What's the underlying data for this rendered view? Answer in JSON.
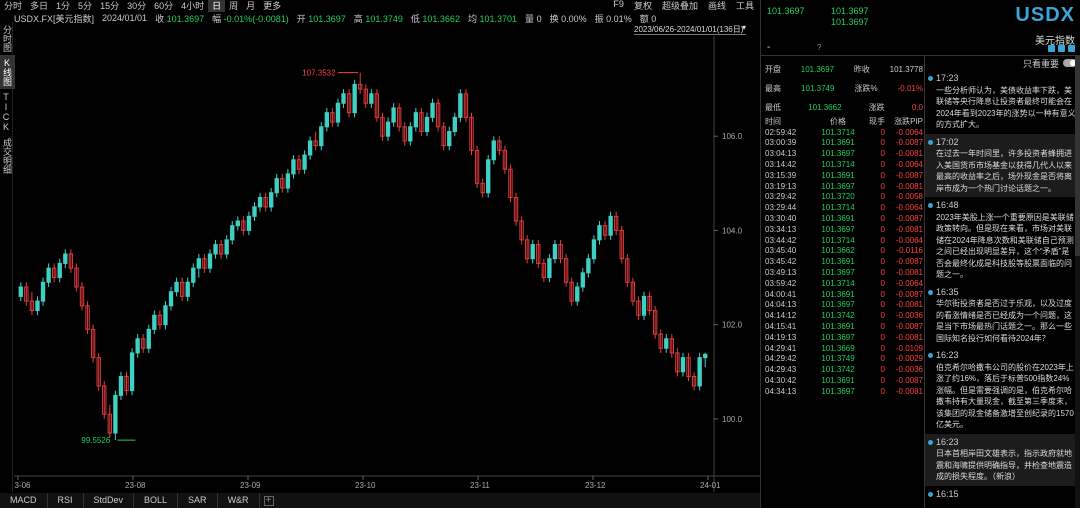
{
  "toolbar": {
    "periods": [
      "分时",
      "多日",
      "1分",
      "5分",
      "15分",
      "30分",
      "60分",
      "4小时",
      "日",
      "周",
      "月",
      "更多"
    ],
    "active_period": "日",
    "right_items": [
      "F9",
      "复权",
      "超级叠加",
      "画线",
      "工具"
    ]
  },
  "infobar": {
    "symbol": "USDX.FX[美元指数]",
    "date": "2024/01/01",
    "close_label": "收",
    "close": "101.3697",
    "change_label": "幅",
    "change": "-0.01%(-0.0081)",
    "open_label": "开",
    "open": "101.3697",
    "high_label": "高",
    "high": "101.3749",
    "low_label": "低",
    "low": "101.3662",
    "avg_label": "均",
    "avg": "101.3701",
    "vol_label": "量",
    "vol": "0",
    "turnover_label": "换",
    "turnover": "0.00%",
    "amp_label": "振",
    "amp": "0.01%",
    "amount_label": "额",
    "amount": "0"
  },
  "left_tabs": [
    "分时图",
    "K线图",
    "TICK",
    "成交明细"
  ],
  "range": "2023/06/26-2024/01/01(136日)",
  "bottom_indicators": [
    "MACD",
    "RSI",
    "StdDev",
    "BOLL",
    "SAR",
    "W&R"
  ],
  "chart_data": {
    "type": "candlestick",
    "ylim": [
      99.0,
      108.0
    ],
    "y_ticks": [
      100.0,
      102.0,
      104.0,
      106.0
    ],
    "y_tick_labels": [
      "100.0",
      "102.0",
      "104.0",
      "106.0"
    ],
    "x_tick_labels": [
      "23-06",
      "23-08",
      "23-09",
      "23-10",
      "23-11",
      "23-12",
      "24-01"
    ],
    "high_marker": "107.3532",
    "low_marker": "99.5526",
    "up_color": "#3fd0c4",
    "down_color": "#e23b3b",
    "candles": [
      [
        102.6,
        102.9,
        102.5,
        102.8
      ],
      [
        102.8,
        102.9,
        102.4,
        102.5
      ],
      [
        102.5,
        102.7,
        102.2,
        102.3
      ],
      [
        102.3,
        102.6,
        102.2,
        102.5
      ],
      [
        102.5,
        103.0,
        102.4,
        102.9
      ],
      [
        102.9,
        103.3,
        102.8,
        103.2
      ],
      [
        103.2,
        103.3,
        102.9,
        103.0
      ],
      [
        103.0,
        103.4,
        102.9,
        103.3
      ],
      [
        103.3,
        103.6,
        103.2,
        103.5
      ],
      [
        103.5,
        103.6,
        103.1,
        103.2
      ],
      [
        103.2,
        103.3,
        102.7,
        102.8
      ],
      [
        102.8,
        102.9,
        102.3,
        102.4
      ],
      [
        102.4,
        102.5,
        101.8,
        101.9
      ],
      [
        101.9,
        102.0,
        101.2,
        101.3
      ],
      [
        101.3,
        101.4,
        100.6,
        100.7
      ],
      [
        100.7,
        100.8,
        100.0,
        100.1
      ],
      [
        100.1,
        100.3,
        99.6,
        99.7
      ],
      [
        99.7,
        100.6,
        99.55,
        100.5
      ],
      [
        100.5,
        101.0,
        100.4,
        100.9
      ],
      [
        100.9,
        101.0,
        100.5,
        100.6
      ],
      [
        100.6,
        101.5,
        100.5,
        101.4
      ],
      [
        101.4,
        101.8,
        101.3,
        101.7
      ],
      [
        101.7,
        101.8,
        101.4,
        101.5
      ],
      [
        101.5,
        102.0,
        101.4,
        101.9
      ],
      [
        101.9,
        102.3,
        101.8,
        102.2
      ],
      [
        102.2,
        102.3,
        101.9,
        102.0
      ],
      [
        102.0,
        102.5,
        101.9,
        102.4
      ],
      [
        102.4,
        102.8,
        102.3,
        102.7
      ],
      [
        102.7,
        103.0,
        102.6,
        102.9
      ],
      [
        102.9,
        103.0,
        102.5,
        102.6
      ],
      [
        102.6,
        103.0,
        102.5,
        102.9
      ],
      [
        102.9,
        103.3,
        102.8,
        103.2
      ],
      [
        103.2,
        103.5,
        103.0,
        103.4
      ],
      [
        103.4,
        103.5,
        103.1,
        103.2
      ],
      [
        103.2,
        103.6,
        103.1,
        103.5
      ],
      [
        103.5,
        103.8,
        103.4,
        103.7
      ],
      [
        103.7,
        103.8,
        103.4,
        103.5
      ],
      [
        103.5,
        103.9,
        103.4,
        103.8
      ],
      [
        103.8,
        104.2,
        103.7,
        104.1
      ],
      [
        104.1,
        104.3,
        104.0,
        104.2
      ],
      [
        104.2,
        104.3,
        103.9,
        104.0
      ],
      [
        104.0,
        104.4,
        103.9,
        104.3
      ],
      [
        104.3,
        104.6,
        104.2,
        104.5
      ],
      [
        104.5,
        104.8,
        104.4,
        104.7
      ],
      [
        104.7,
        104.8,
        104.4,
        104.5
      ],
      [
        104.5,
        104.9,
        104.4,
        104.8
      ],
      [
        104.8,
        105.2,
        104.7,
        105.1
      ],
      [
        105.1,
        105.2,
        104.8,
        104.9
      ],
      [
        104.9,
        105.3,
        104.8,
        105.2
      ],
      [
        105.2,
        105.6,
        105.1,
        105.5
      ],
      [
        105.5,
        105.6,
        105.2,
        105.3
      ],
      [
        105.3,
        105.7,
        105.2,
        105.6
      ],
      [
        105.6,
        106.0,
        105.5,
        105.9
      ],
      [
        105.9,
        106.1,
        105.7,
        105.8
      ],
      [
        105.8,
        106.3,
        105.7,
        106.2
      ],
      [
        106.2,
        106.6,
        106.1,
        106.5
      ],
      [
        106.5,
        106.6,
        106.2,
        106.3
      ],
      [
        106.3,
        106.8,
        106.2,
        106.7
      ],
      [
        106.7,
        107.0,
        106.6,
        106.9
      ],
      [
        106.9,
        107.0,
        106.4,
        106.5
      ],
      [
        106.5,
        107.2,
        106.4,
        107.1
      ],
      [
        107.1,
        107.35,
        106.9,
        107.0
      ],
      [
        107.0,
        107.1,
        106.6,
        106.7
      ],
      [
        106.7,
        107.0,
        106.6,
        106.9
      ],
      [
        106.9,
        107.0,
        106.3,
        106.4
      ],
      [
        106.4,
        106.5,
        105.9,
        106.0
      ],
      [
        106.0,
        106.4,
        105.9,
        106.3
      ],
      [
        106.3,
        106.7,
        106.2,
        106.6
      ],
      [
        106.6,
        106.7,
        106.1,
        106.2
      ],
      [
        106.2,
        106.3,
        105.8,
        105.9
      ],
      [
        105.9,
        106.3,
        105.8,
        106.2
      ],
      [
        106.2,
        106.6,
        106.1,
        106.5
      ],
      [
        106.5,
        106.6,
        106.0,
        106.1
      ],
      [
        106.1,
        106.5,
        106.0,
        106.4
      ],
      [
        106.4,
        106.8,
        106.3,
        106.7
      ],
      [
        106.7,
        106.8,
        106.1,
        106.2
      ],
      [
        106.2,
        106.3,
        105.7,
        105.8
      ],
      [
        105.8,
        106.2,
        105.7,
        106.1
      ],
      [
        106.1,
        106.5,
        106.0,
        106.4
      ],
      [
        106.4,
        107.0,
        106.3,
        106.9
      ],
      [
        106.9,
        107.0,
        106.3,
        106.4
      ],
      [
        106.4,
        106.5,
        105.6,
        105.7
      ],
      [
        105.7,
        105.8,
        104.9,
        105.0
      ],
      [
        105.0,
        105.1,
        104.7,
        104.8
      ],
      [
        104.8,
        105.6,
        104.7,
        105.5
      ],
      [
        105.5,
        106.0,
        105.4,
        105.9
      ],
      [
        105.9,
        106.0,
        105.6,
        105.7
      ],
      [
        105.7,
        105.8,
        105.2,
        105.3
      ],
      [
        105.3,
        105.4,
        104.6,
        104.7
      ],
      [
        104.7,
        104.8,
        104.1,
        104.2
      ],
      [
        104.2,
        104.3,
        103.7,
        103.8
      ],
      [
        103.8,
        103.9,
        103.3,
        103.4
      ],
      [
        103.4,
        103.8,
        103.3,
        103.7
      ],
      [
        103.7,
        103.8,
        103.2,
        103.3
      ],
      [
        103.3,
        103.4,
        102.9,
        103.0
      ],
      [
        103.0,
        103.5,
        102.9,
        103.4
      ],
      [
        103.4,
        103.8,
        103.3,
        103.7
      ],
      [
        103.7,
        103.8,
        103.3,
        103.4
      ],
      [
        103.4,
        103.5,
        102.8,
        102.9
      ],
      [
        102.9,
        103.0,
        102.4,
        102.5
      ],
      [
        102.5,
        102.9,
        102.4,
        102.8
      ],
      [
        102.8,
        103.2,
        102.7,
        103.1
      ],
      [
        103.1,
        103.5,
        103.0,
        103.4
      ],
      [
        103.4,
        103.9,
        103.3,
        103.8
      ],
      [
        103.8,
        104.2,
        103.7,
        104.1
      ],
      [
        104.1,
        104.2,
        103.8,
        103.9
      ],
      [
        103.9,
        104.4,
        103.8,
        104.3
      ],
      [
        104.3,
        104.4,
        103.9,
        104.0
      ],
      [
        104.0,
        104.1,
        103.3,
        103.4
      ],
      [
        103.4,
        103.5,
        102.8,
        102.9
      ],
      [
        102.9,
        103.0,
        102.4,
        102.5
      ],
      [
        102.5,
        102.6,
        102.1,
        102.2
      ],
      [
        102.2,
        102.7,
        102.1,
        102.6
      ],
      [
        102.6,
        102.7,
        102.2,
        102.3
      ],
      [
        102.3,
        102.4,
        101.7,
        101.8
      ],
      [
        101.8,
        101.9,
        101.4,
        101.5
      ],
      [
        101.5,
        101.8,
        101.4,
        101.7
      ],
      [
        101.7,
        101.8,
        101.3,
        101.4
      ],
      [
        101.4,
        101.5,
        100.9,
        101.0
      ],
      [
        101.0,
        101.4,
        100.9,
        101.3
      ],
      [
        101.3,
        101.4,
        100.8,
        100.9
      ],
      [
        100.9,
        101.0,
        100.6,
        100.7
      ],
      [
        100.7,
        101.4,
        100.6,
        101.3
      ],
      [
        101.3,
        101.4,
        101.1,
        101.37
      ]
    ]
  },
  "quote": {
    "price_main": "101.3697",
    "price_2": "101.3697",
    "price_3": "101.3697",
    "symbol_big": "USDX",
    "symbol_name": "美元指数",
    "dash": "-",
    "question": "?"
  },
  "stats": [
    {
      "l1": "开盘",
      "v1": "101.3697",
      "l2": "昨收",
      "v2": "101.3778"
    },
    {
      "l1": "最高",
      "v1": "101.3749",
      "l2": "涨跌%",
      "v2": "-0.01%"
    },
    {
      "l1": "最低",
      "v1": "101.3662",
      "l2": "涨跌",
      "v2": "0.0"
    }
  ],
  "trades": {
    "headers": [
      "时间",
      "价格",
      "现手",
      "涨跌PIP"
    ],
    "rows": [
      [
        "02:59:42",
        "101.3714",
        "0",
        "-0.0064"
      ],
      [
        "03:00:39",
        "101.3691",
        "0",
        "-0.0087"
      ],
      [
        "03:04:13",
        "101.3697",
        "0",
        "-0.0081"
      ],
      [
        "03:14:42",
        "101.3714",
        "0",
        "-0.0064"
      ],
      [
        "03:15:39",
        "101.3691",
        "0",
        "-0.0087"
      ],
      [
        "03:19:13",
        "101.3697",
        "0",
        "-0.0081"
      ],
      [
        "03:29:42",
        "101.3720",
        "0",
        "-0.0058"
      ],
      [
        "03:29:44",
        "101.3714",
        "0",
        "-0.0064"
      ],
      [
        "03:30:40",
        "101.3691",
        "0",
        "-0.0087"
      ],
      [
        "03:34:13",
        "101.3697",
        "0",
        "-0.0081"
      ],
      [
        "03:44:42",
        "101.3714",
        "0",
        "-0.0064"
      ],
      [
        "03:45:40",
        "101.3662",
        "0",
        "-0.0116"
      ],
      [
        "03:45:42",
        "101.3691",
        "0",
        "-0.0087"
      ],
      [
        "03:49:13",
        "101.3697",
        "0",
        "-0.0081"
      ],
      [
        "03:59:42",
        "101.3714",
        "0",
        "-0.0064"
      ],
      [
        "04:00:41",
        "101.3691",
        "0",
        "-0.0087"
      ],
      [
        "04:04:13",
        "101.3697",
        "0",
        "-0.0081"
      ],
      [
        "04:14:12",
        "101.3742",
        "0",
        "-0.0036"
      ],
      [
        "04:15:41",
        "101.3691",
        "0",
        "-0.0087"
      ],
      [
        "04:19:13",
        "101.3697",
        "0",
        "-0.0081"
      ],
      [
        "04:29:41",
        "101.3669",
        "0",
        "-0.0109"
      ],
      [
        "04:29:42",
        "101.3749",
        "0",
        "-0.0029"
      ],
      [
        "04:29:43",
        "101.3742",
        "0",
        "-0.0036"
      ],
      [
        "04:30:42",
        "101.3691",
        "0",
        "-0.0087"
      ],
      [
        "04:34:13",
        "101.3697",
        "0",
        "-0.0081"
      ]
    ]
  },
  "news": {
    "only_important_label": "只看重要",
    "items": [
      {
        "time": "17:23",
        "text": "一些分析师认为，美债收益率下跌，美联储等央行降息让投资者最终可能会在2024年看到2023年的涨势以一种有意义的方式扩大。",
        "hl": false
      },
      {
        "time": "17:02",
        "text": "在过去一年时间里，许多投资者蜂拥进入美国货币市场基金以获得几代人以来最高的收益率之后，场外现金是否将离岸市成为一个热门讨论话题之一。",
        "hl": true
      },
      {
        "time": "16:48",
        "text": "2023年美股上涨一个重要原因是美联储政策转向。但是现在来看，市场对美联储在2024年降息次数和美联储自己预测之间已经出现明显差异，这个“矛盾”是否会最终化成是科技股等股票面临的问题之一。",
        "hl": false
      },
      {
        "time": "16:35",
        "text": "华尔街投资者是否过于乐观，以及过度的看涨情绪是否已经成为一个问题，这是当下市场最热门话题之一。那么一些国际知名投行如何看待2024年？",
        "hl": false
      },
      {
        "time": "16:23",
        "text": "伯克希尔哈撒韦公司的股价在2023年上涨了约16%，落后于标普500指数24%涨幅。但是需要强调的是，伯克希尔哈撒韦持有大量现金，截至第三季度末，该集团的现金储备激增至创纪录的1570亿美元。",
        "hl": false
      },
      {
        "time": "16:23",
        "text": "日本首相岸田文雄表示，指示政府就地震和海啸提供明确指导，并检查地震造成的损失程度。（新浪）",
        "hl": true
      },
      {
        "time": "16:15",
        "text": "",
        "hl": false
      }
    ]
  }
}
